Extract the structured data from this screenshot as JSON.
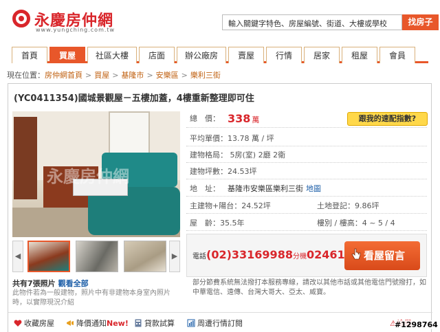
{
  "header": {
    "logo_text": "永慶房仲網",
    "logo_url": "www.yungching.com.tw",
    "search_placeholder": "輸入關鍵字特色、房屋編號、街道、大樓或學校",
    "search_button": "找房子"
  },
  "nav": [
    "首頁",
    "買屋",
    "社區大樓",
    "店面",
    "辦公廠房",
    "賣屋",
    "行情",
    "居家",
    "租屋",
    "會員"
  ],
  "breadcrumb": {
    "prefix": "現在位置：",
    "items": [
      "房仲網首頁",
      "買屋",
      "基隆市",
      "安樂區",
      "樂利三街"
    ],
    "sep": ">"
  },
  "listing": {
    "title": "(YC0411354)國城景觀屋－五樓加蓋，4樓重新整理即可住",
    "photo_watermark": "永慶房仲網",
    "photo_count": "共有7張照片",
    "view_all": "觀看全部",
    "photo_note": "此物件若為一般建物，照片中有非建物本身室內照片時，以實際現況介紹",
    "price_label": "總　價：",
    "price": "338",
    "price_unit": "萬",
    "index_button": "跟我的速配指數?",
    "unit_price": "平均單價：13.78 萬 / 坪",
    "layout": "建物格局： 5房(室) 2廳 2衛",
    "area": "建物坪數：24.53坪",
    "address_label": "地　址：",
    "address": "基隆市安樂區樂利三街",
    "map_link": "地圖",
    "main_building": "主建物+陽台：24.52坪",
    "land": "土地登記：9.86坪",
    "age": "屋　齡：35.5年",
    "floors": "樓別 / 樓高：4 ~ 5 / 4"
  },
  "contact": {
    "phone_label": "電話",
    "phone": "(02)33169988",
    "ext_label": "分機",
    "ext": "02461",
    "message_button": "看屋留言",
    "notice": "部分節費系統無法撥打本服務專線，請改以其他市話或其他電信門號撥打，如中華電信、遠傳、台灣大哥大、亞太、威寶。"
  },
  "toolbar": {
    "favorite": "收藏房屋",
    "price_alert": "降價通知",
    "price_alert_badge": "New!",
    "loan": "貸款試算",
    "market": "周遭行情訂閱",
    "report": "檢舉"
  },
  "watermark": "#1298764",
  "colors": {
    "accent": "#e8572a",
    "price": "#d9262b",
    "link": "#1e5fa8"
  }
}
